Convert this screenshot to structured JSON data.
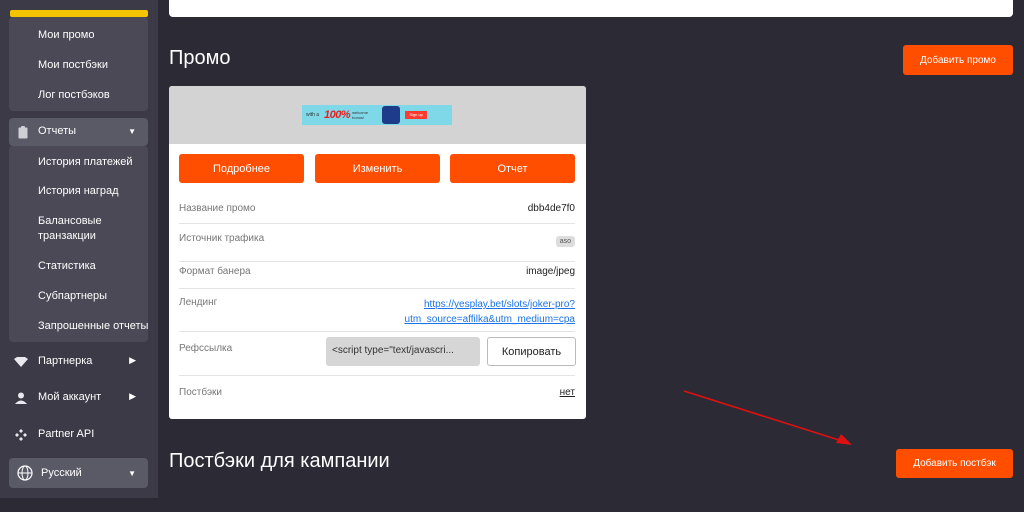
{
  "sidebar": {
    "postback_items": [
      "Мои промо",
      "Мои постбэки",
      "Лог постбэков"
    ],
    "reports": {
      "label": "Отчеты",
      "items": [
        "История платежей",
        "История наград",
        "Балансовые",
        "транзакции",
        "Статистика",
        "Субпартнеры",
        "Запрошенные отчеты"
      ]
    },
    "partner": "Партнерка",
    "account": "Мой аккаунт",
    "api": "Partner API",
    "language": "Русский"
  },
  "promo": {
    "title": "Промо",
    "add_button": "Добавить промо",
    "banner": {
      "small1": "with a",
      "big": "100%",
      "small2": "welcome bonus!",
      "cta": "Sign up"
    },
    "buttons": {
      "details": "Подробнее",
      "edit": "Изменить",
      "report": "Отчет"
    },
    "rows": {
      "name_label": "Название промо",
      "name_value": "dbb4de7f0",
      "source_label": "Источник трафика",
      "source_value": "aso",
      "format_label": "Формат банера",
      "format_value": "image/jpeg",
      "landing_label": "Лендинг",
      "landing_line1": "https://yesplay.bet/slots/joker-pro?",
      "landing_line2": "utm_source=affilka&utm_medium=cpa",
      "ref_label": "Рефссылка",
      "ref_value": "<script type=\"text/javascri...",
      "copy_button": "Копировать",
      "postbacks_label": "Постбэки",
      "postbacks_value": "нет"
    }
  },
  "campaign": {
    "title": "Постбэки для кампании",
    "add_button": "Добавить постбэк"
  },
  "colors": {
    "accent": "#ff4e00",
    "highlight": "#f5c400",
    "background": "#2b2a35",
    "arrow": "#e01010"
  },
  "icons": [
    "clipboard-icon",
    "chevron-down-icon",
    "diamond-icon",
    "chevron-right-icon",
    "user-icon",
    "api-icon",
    "globe-icon"
  ]
}
